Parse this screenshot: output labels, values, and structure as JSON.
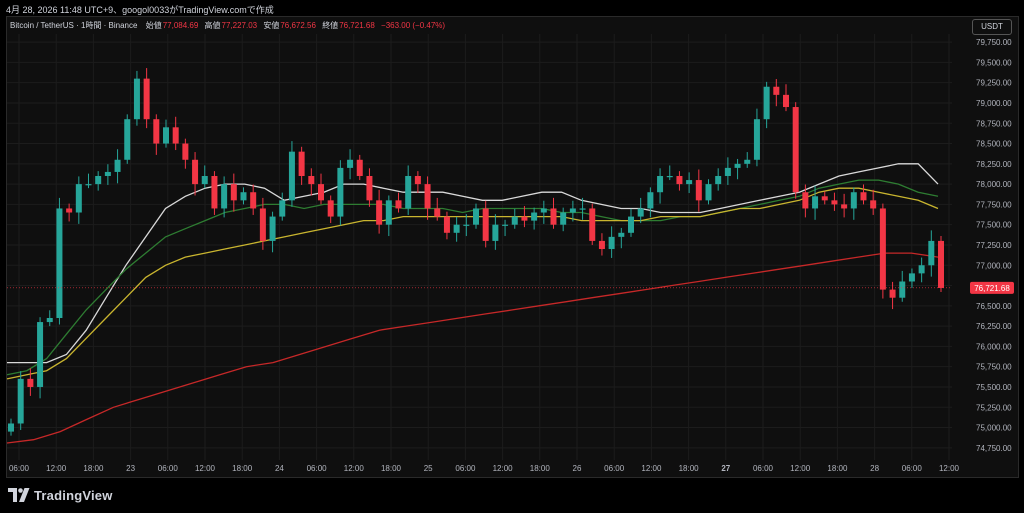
{
  "header": {
    "snapshot_text": "4月 28, 2026 11:48 UTC+9、googol0033がTradingView.comで作成"
  },
  "legend": {
    "symbol": "Bitcoin / TetherUS · 1時間 · Binance",
    "open_label": "始値",
    "open_value": "77,084.69",
    "high_label": "高値",
    "high_value": "77,227.03",
    "low_label": "安値",
    "low_value": "76,672.56",
    "close_label": "終値",
    "close_value": "76,721.68",
    "change": "−363.00 (−0.47%)"
  },
  "currency_button": "USDT",
  "last_price_label": "76,721.68",
  "footer": {
    "brand": "TradingView"
  },
  "colors": {
    "up": "#26a69a",
    "down": "#f23645",
    "ma_fast": "#d9d9d9",
    "ma_mid": "#2e7d32",
    "ma_slow": "#c9b52f",
    "ma_long": "#c62828",
    "background": "#0f0f0f"
  },
  "chart_data": {
    "type": "candlestick",
    "symbol": "BTC/USDT",
    "timeframe": "1時間",
    "ylim": [
      74600,
      79850
    ],
    "yticks": [
      "79,750.00",
      "79,500.00",
      "79,250.00",
      "79,000.00",
      "78,750.00",
      "78,500.00",
      "78,250.00",
      "78,000.00",
      "77,750.00",
      "77,500.00",
      "77,250.00",
      "77,000.00",
      "76,750.00",
      "76,500.00",
      "76,250.00",
      "76,000.00",
      "75,750.00",
      "75,500.00",
      "75,250.00",
      "75,000.00",
      "74,750.00"
    ],
    "xticks": [
      "06:00",
      "12:00",
      "18:00",
      "23",
      "06:00",
      "12:00",
      "18:00",
      "24",
      "06:00",
      "12:00",
      "18:00",
      "25",
      "06:00",
      "12:00",
      "18:00",
      "26",
      "06:00",
      "12:00",
      "18:00",
      "27",
      "06:00",
      "12:00",
      "18:00",
      "28",
      "06:00",
      "12:00"
    ],
    "xtick_bold": [
      "27"
    ],
    "last_price": 76721.68,
    "price_series": [
      75050,
      75600,
      75500,
      76300,
      76350,
      77700,
      77650,
      78000,
      78000,
      78100,
      78150,
      78300,
      78800,
      79300,
      78800,
      78500,
      78700,
      78500,
      78300,
      78000,
      78100,
      77700,
      78000,
      77800,
      77900,
      77700,
      77300,
      77600,
      77800,
      78400,
      78100,
      78000,
      77800,
      77600,
      78200,
      78300,
      78100,
      77800,
      77500,
      77800,
      77700,
      78100,
      78000,
      77700,
      77600,
      77400,
      77500,
      77500,
      77700,
      77300,
      77500,
      77500,
      77600,
      77550,
      77650,
      77700,
      77500,
      77650,
      77700,
      77700,
      77300,
      77200,
      77350,
      77400,
      77600,
      77700,
      77900,
      78100,
      78100,
      78000,
      78050,
      77800,
      78000,
      78100,
      78200,
      78250,
      78300,
      78800,
      79200,
      79100,
      78950,
      77900,
      77700,
      77850,
      77800,
      77750,
      77700,
      77900,
      77800,
      77700,
      76700,
      76600,
      76800,
      76900,
      77000,
      77300,
      76720
    ],
    "series": [
      {
        "name": "MA fast",
        "values": [
          75800,
          75800,
          75800,
          75900,
          76200,
          76600,
          77000,
          77350,
          77700,
          77850,
          77950,
          78000,
          78000,
          77950,
          77800,
          77850,
          77900,
          78000,
          78000,
          77950,
          77900,
          77900,
          77900,
          77850,
          77800,
          77800,
          77850,
          77900,
          77900,
          77800,
          77750,
          77700,
          77700,
          77650,
          77650,
          77650,
          77700,
          77750,
          77800,
          77850,
          77900,
          78000,
          78100,
          78150,
          78200,
          78250,
          78250,
          78000
        ]
      },
      {
        "name": "MA mid",
        "values": [
          75650,
          75700,
          75850,
          76150,
          76450,
          76700,
          76950,
          77150,
          77350,
          77450,
          77550,
          77650,
          77700,
          77750,
          77750,
          77700,
          77750,
          77750,
          77750,
          77750,
          77700,
          77700,
          77700,
          77650,
          77700,
          77700,
          77700,
          77700,
          77650,
          77650,
          77600,
          77550,
          77550,
          77550,
          77600,
          77600,
          77650,
          77700,
          77750,
          77800,
          77850,
          77950,
          78000,
          78050,
          78050,
          78000,
          77900,
          77850
        ]
      },
      {
        "name": "MA slow",
        "values": [
          75600,
          75650,
          75700,
          75850,
          76100,
          76350,
          76600,
          76850,
          77000,
          77100,
          77150,
          77200,
          77250,
          77300,
          77350,
          77400,
          77450,
          77500,
          77550,
          77550,
          77600,
          77600,
          77600,
          77600,
          77600,
          77600,
          77600,
          77600,
          77600,
          77550,
          77550,
          77550,
          77550,
          77600,
          77600,
          77600,
          77650,
          77700,
          77700,
          77750,
          77800,
          77900,
          77950,
          77950,
          77900,
          77850,
          77800,
          77700
        ]
      },
      {
        "name": "MA long",
        "values": [
          74810,
          74850,
          74950,
          75100,
          75250,
          75350,
          75450,
          75550,
          75650,
          75750,
          75800,
          75900,
          76000,
          76100,
          76200,
          76250,
          76300,
          76350,
          76400,
          76450,
          76500,
          76550,
          76600,
          76650,
          76700,
          76750,
          76800,
          76850,
          76900,
          76950,
          77000,
          77050,
          77100,
          77150,
          77150,
          77100
        ]
      }
    ]
  }
}
